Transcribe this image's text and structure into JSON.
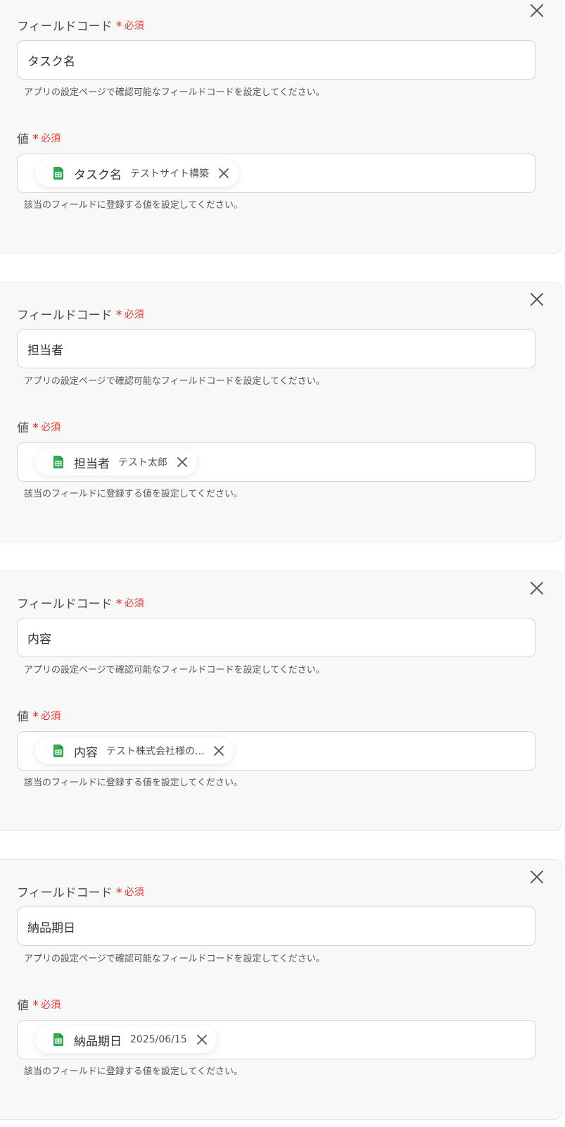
{
  "field_code_label": "フィールドコード",
  "value_label": "値",
  "asterisk": "*",
  "required_label": "必須",
  "field_code_help": "アプリの設定ページで確認可能なフィールドコードを設定してください。",
  "value_help": "該当のフィールドに登録する値を設定してください。",
  "icons": {
    "close": "close-icon",
    "sheet": "google-sheets-icon",
    "chip_remove": "close-icon"
  },
  "colors": {
    "required": "#e53935",
    "sheet_green": "#34a853"
  },
  "cards": [
    {
      "field_code": "タスク名",
      "chip_name": "タスク名",
      "chip_value": "テストサイト構築"
    },
    {
      "field_code": "担当者",
      "chip_name": "担当者",
      "chip_value": "テスト太郎"
    },
    {
      "field_code": "内容",
      "chip_name": "内容",
      "chip_value": "テスト株式会社様の..."
    },
    {
      "field_code": "納品期日",
      "chip_name": "納品期日",
      "chip_value": "2025/06/15"
    }
  ]
}
